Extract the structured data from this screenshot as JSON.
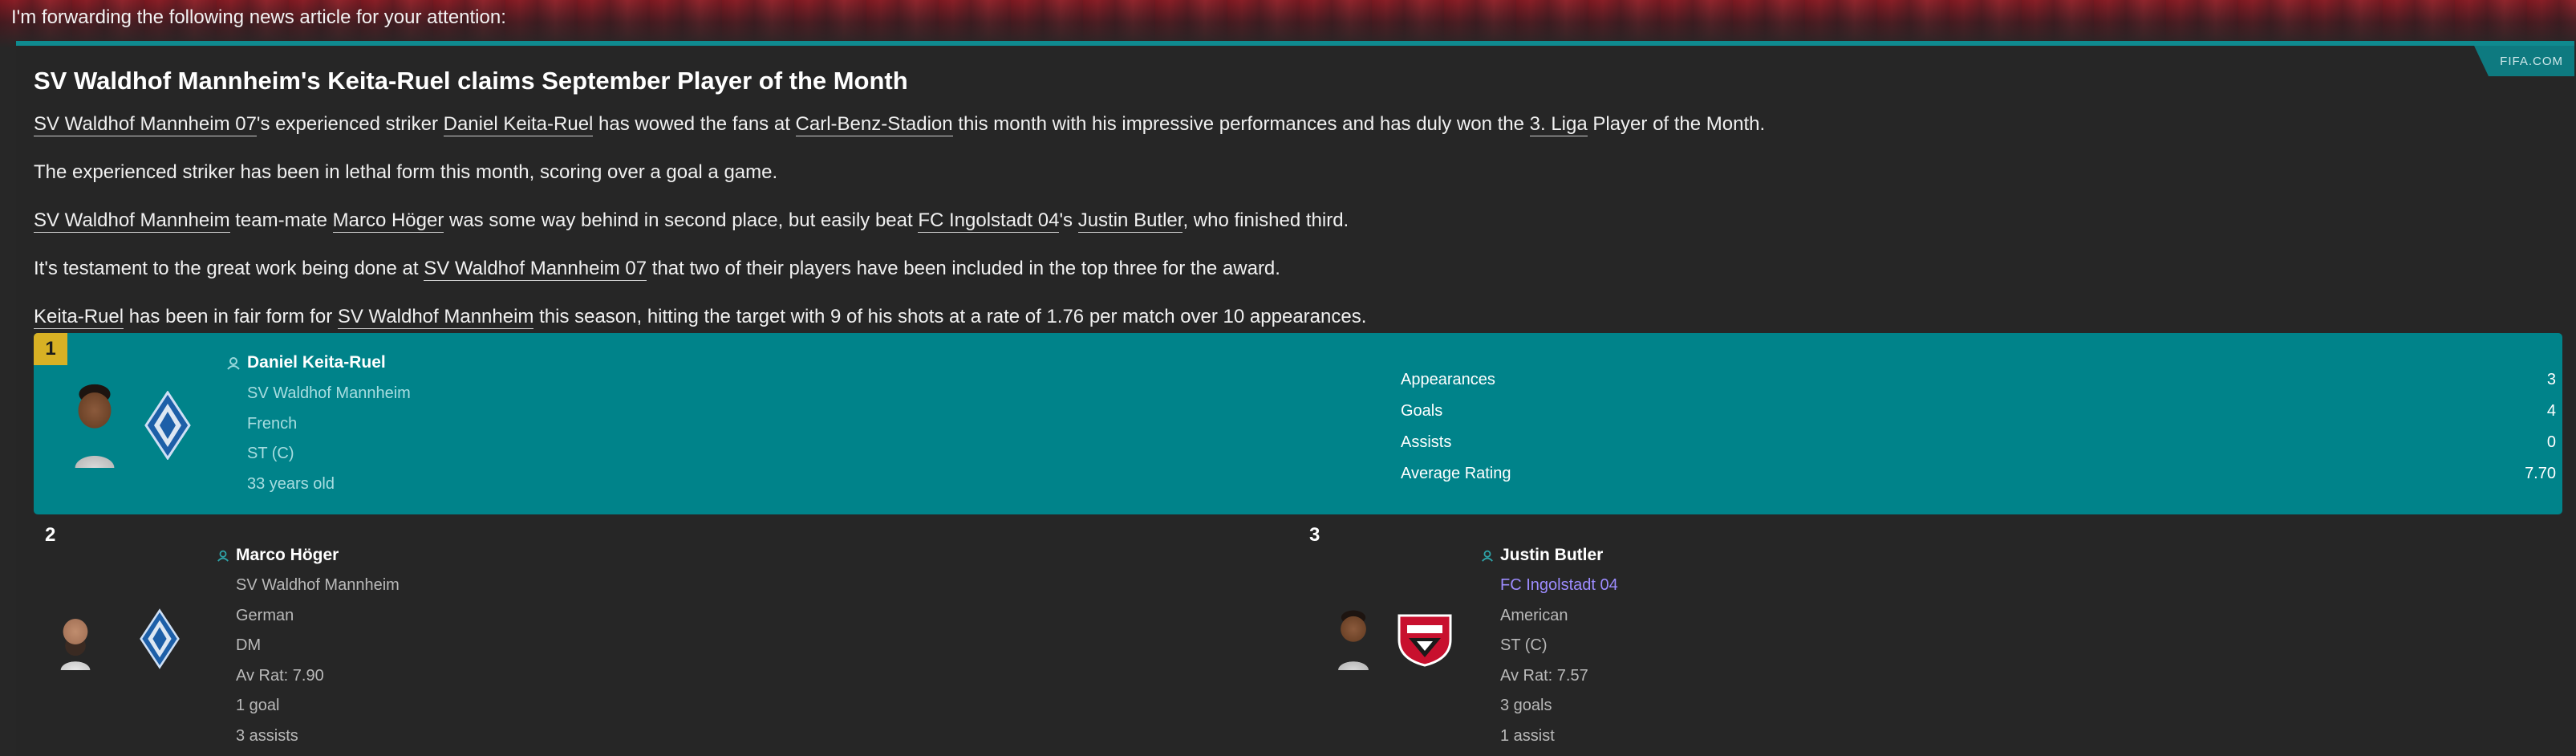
{
  "intro": "I'm forwarding the following news article for your attention:",
  "source_tag": "FIFA.COM",
  "headline": "SV Waldhof Mannheim's Keita-Ruel claims September Player of the Month",
  "paragraphs": {
    "p1": {
      "club": "SV Waldhof Mannheim 07",
      "t1": "'s experienced striker ",
      "player": "Daniel Keita-Ruel",
      "t2": " has wowed the fans at ",
      "stadium": "Carl-Benz-Stadion",
      "t3": " this month with his impressive performances and has duly won the ",
      "league": "3. Liga",
      "t4": " Player of the Month."
    },
    "p2": "The experienced striker has been in lethal form this month, scoring over a goal a game.",
    "p3": {
      "club": "SV Waldhof Mannheim",
      "t1": " team-mate ",
      "player2": "Marco Höger",
      "t2": " was some way behind in second place, but easily beat ",
      "club3": "FC Ingolstadt 04",
      "t3": "'s ",
      "player3": "Justin Butler",
      "t4": ", who finished third."
    },
    "p4": {
      "t1": "It's testament to the great work being done at ",
      "club": "SV Waldhof Mannheim 07",
      "t2": " that two of their players have been included in the top three for the award."
    },
    "p5": {
      "player": "Keita-Ruel",
      "t1": " has been in fair form for ",
      "club": "SV Waldhof Mannheim",
      "t2": " this season, hitting the target with 9 of his shots at a rate of 1.76 per match over 10 appearances."
    }
  },
  "winner": {
    "rank": "1",
    "name": "Daniel Keita-Ruel",
    "club": "SV Waldhof Mannheim",
    "nationality": "French",
    "position": "ST (C)",
    "age": "33 years old",
    "stats": [
      {
        "label": "Appearances",
        "value": "3"
      },
      {
        "label": "Goals",
        "value": "4"
      },
      {
        "label": "Assists",
        "value": "0"
      },
      {
        "label": "Average Rating",
        "value": "7.70"
      }
    ]
  },
  "runners_up": [
    {
      "rank": "2",
      "name": "Marco Höger",
      "club": "SV Waldhof Mannheim",
      "nationality": "German",
      "position": "DM",
      "rating": "Av Rat: 7.90",
      "goals": "1 goal",
      "assists": "3 assists"
    },
    {
      "rank": "3",
      "name": "Justin Butler",
      "club": "FC Ingolstadt 04",
      "nationality": "American",
      "position": "ST (C)",
      "rating": "Av Rat: 7.57",
      "goals": "3 goals",
      "assists": "1 assist"
    }
  ],
  "colors": {
    "accent": "#00838a",
    "gold": "#d8b124",
    "link_purple": "#9d8cff"
  }
}
